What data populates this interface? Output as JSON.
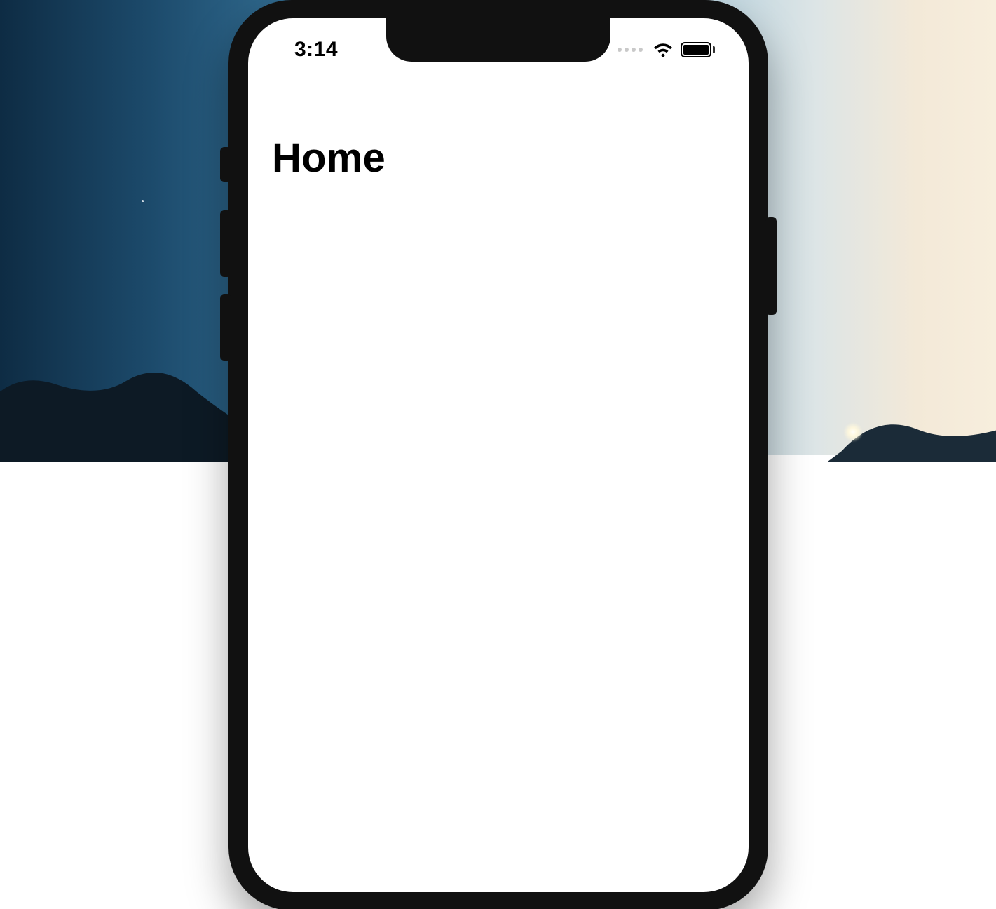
{
  "status_bar": {
    "time": "3:14"
  },
  "page": {
    "title": "Home"
  }
}
